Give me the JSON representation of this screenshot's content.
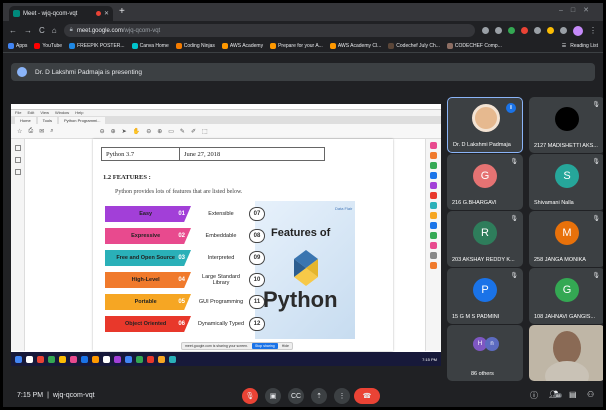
{
  "browser": {
    "tab_title": "Meet - wjq-qcom-vqt",
    "new_tab": "+",
    "url_host": "meet.google.com",
    "url_path": "/wjq-qcom-vqt",
    "bookmarks": [
      "Apps",
      "YouTube",
      "FREEPIK POSTER...",
      "Canva Home",
      "Coding Ninjas",
      "AWS Academy",
      "Prepare for your A...",
      "AWS Academy Cl...",
      "Codechef July Ch...",
      "CODECHEF Comp..."
    ],
    "bookmark_colors": [
      "#4285f4",
      "#ff0000",
      "#1e88e5",
      "#00c4cc",
      "#f57c00",
      "#ff9900",
      "#ff9900",
      "#ff9900",
      "#5b4638",
      "#8d6e63"
    ],
    "reading_list": "Reading List"
  },
  "presenting": {
    "text": "Dr. D Lakshmi Padmaja is presenting"
  },
  "shared_doc": {
    "menu": [
      "File",
      "Edit",
      "View",
      "Window",
      "Help"
    ],
    "tabs": [
      "Home",
      "Tools",
      "Python Programmi..."
    ],
    "table_left": "Python 3.7",
    "table_right": "June 27, 2018",
    "heading": "1.2 FEATURES :",
    "para": "Python provides lots of features that are listed below.",
    "infographic_title": "Features of",
    "infographic_word": "Python",
    "brand": "Data Flair",
    "features_left": [
      {
        "label": "Easy",
        "num": "01",
        "color": "#a23fd8"
      },
      {
        "label": "Expressive",
        "num": "02",
        "color": "#e84a8e"
      },
      {
        "label": "Free and Open Source",
        "num": "03",
        "color": "#2ab0b8"
      },
      {
        "label": "High-Level",
        "num": "04",
        "color": "#f07a2c"
      },
      {
        "label": "Portable",
        "num": "05",
        "color": "#f6a623"
      },
      {
        "label": "Object Oriented",
        "num": "06",
        "color": "#e8382b"
      }
    ],
    "features_right": [
      {
        "label": "Extensible",
        "num": "07"
      },
      {
        "label": "Embeddable",
        "num": "08"
      },
      {
        "label": "Interpreted",
        "num": "09"
      },
      {
        "label": "Large Standard Library",
        "num": "10"
      },
      {
        "label": "GUI Programming",
        "num": "11"
      },
      {
        "label": "Dynamically Typed",
        "num": "12"
      }
    ],
    "share_notice": "meet.google.com is sharing your screen.",
    "stop_sharing": "Stop sharing",
    "hide": "Hide",
    "taskbar_time": "7:15 PM"
  },
  "participants": [
    {
      "name": "Dr. D Lakshmi Padmaja",
      "initial": "",
      "color": "",
      "muted": false
    },
    {
      "name": "2127 MADISHETTI AKS...",
      "initial": "",
      "color": "#000000",
      "muted": true
    },
    {
      "name": "216 G.BHARGAVI",
      "initial": "G",
      "color": "#e57373",
      "muted": true
    },
    {
      "name": "Shivamani Nalla",
      "initial": "S",
      "color": "#26a69a",
      "muted": true
    },
    {
      "name": "203 AKSHAY REDDY K...",
      "initial": "R",
      "color": "#2e7d5b",
      "muted": true
    },
    {
      "name": "258 JANGA MONIKA",
      "initial": "M",
      "color": "#e8710a",
      "muted": true
    },
    {
      "name": "15 G M S PADMINI",
      "initial": "P",
      "color": "#1a73e8",
      "muted": true
    },
    {
      "name": "108 JAHNAVI GANGIS...",
      "initial": "G",
      "color": "#34a853",
      "muted": true
    }
  ],
  "others": {
    "label": "86 others",
    "initials": [
      "H",
      "n"
    ]
  },
  "meeting": {
    "time": "7:15 PM",
    "separator": "|",
    "code": "wjq-qcom-vqt",
    "people_count": "88"
  }
}
